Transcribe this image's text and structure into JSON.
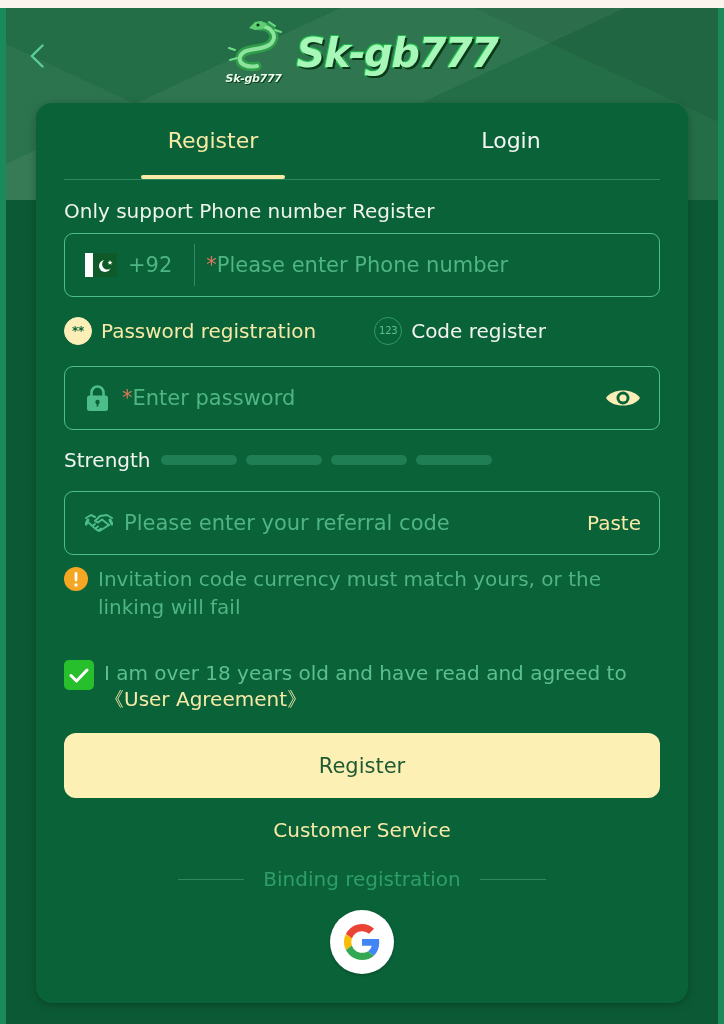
{
  "logo": {
    "emblem_text": "Sk-gb777",
    "text": "Sk-gb777"
  },
  "tabs": [
    {
      "label": "Register",
      "selected": true
    },
    {
      "label": "Login",
      "selected": false
    }
  ],
  "phone_note": "Only support Phone number Register",
  "phone_field": {
    "country_code": "+92",
    "required_mark": "*",
    "placeholder": "Please enter Phone number"
  },
  "registration_modes": [
    {
      "icon_text": "**",
      "label": "Password registration",
      "selected": true
    },
    {
      "icon_text": "123",
      "label": "Code register",
      "selected": false
    }
  ],
  "password_field": {
    "required_mark": "*",
    "placeholder": "Enter password"
  },
  "strength": {
    "label": "Strength",
    "segments": [
      {
        "filled": false
      },
      {
        "filled": false
      },
      {
        "filled": false
      },
      {
        "filled": false
      }
    ]
  },
  "referral_field": {
    "placeholder": "Please enter your referral code",
    "paste": "Paste"
  },
  "warning": "Invitation code currency must match yours, or the linking will fail",
  "agreement": {
    "checked": true,
    "text": "I am over 18 years old and have read and agreed to",
    "link": "《User Agreement》"
  },
  "register_button": "Register",
  "customer_service": "Customer Service",
  "binding": {
    "label": "Binding registration"
  }
}
